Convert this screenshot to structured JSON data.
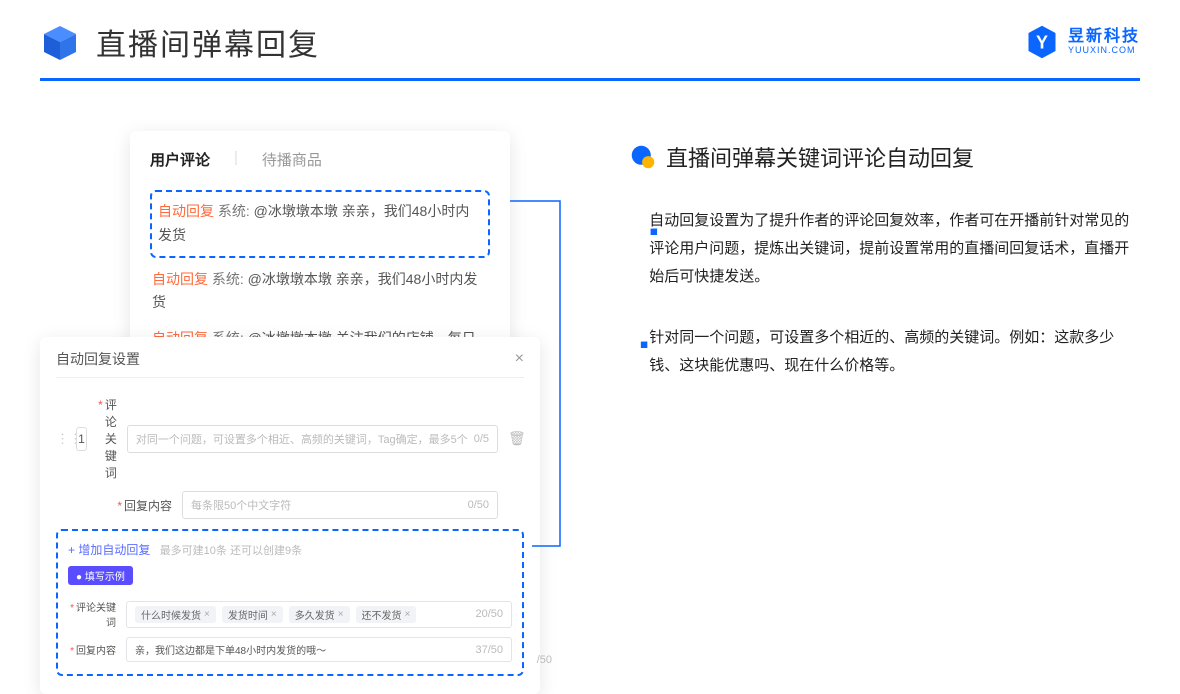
{
  "header": {
    "title": "直播间弹幕回复",
    "brand_cn": "昱新科技",
    "brand_en": "YUUXIN.COM"
  },
  "comments": {
    "tab_active": "用户评论",
    "tab_inactive": "待播商品",
    "items": [
      {
        "badge": "自动回复",
        "sys": "系统:",
        "text": "@冰墩墩本墩 亲亲，我们48小时内发货"
      },
      {
        "badge": "自动回复",
        "sys": "系统:",
        "text": "@冰墩墩本墩 亲亲，我们48小时内发货"
      },
      {
        "badge": "自动回复",
        "sys": "系统:",
        "text": "@冰墩墩本墩 关注我们的店铺，每日都有热门推荐呦～"
      }
    ]
  },
  "settings": {
    "title": "自动回复设置",
    "seq": "1",
    "keyword_label": "评论关键词",
    "keyword_placeholder": "对同一个问题，可设置多个相近、高频的关键词，Tag确定，最多5个",
    "keyword_counter": "0/5",
    "content_label": "回复内容",
    "content_placeholder": "每条限50个中文字符",
    "content_counter": "0/50",
    "add_link": "+ 增加自动回复",
    "add_tip": "最多可建10条 还可以创建9条",
    "example_badge": "● 填写示例",
    "ex_keyword_label": "评论关键词",
    "ex_tags": [
      "什么时候发货",
      "发货时间",
      "多久发货",
      "还不发货"
    ],
    "ex_keyword_counter": "20/50",
    "ex_content_label": "回复内容",
    "ex_content_value": "亲，我们这边都是下单48小时内发货的哦～",
    "ex_content_counter": "37/50",
    "stray_counter": "/50"
  },
  "right": {
    "title": "直播间弹幕关键词评论自动回复",
    "bullets": [
      "自动回复设置为了提升作者的评论回复效率，作者可在开播前针对常见的评论用户问题，提炼出关键词，提前设置常用的直播间回复话术，直播开始后可快捷发送。",
      "针对同一个问题，可设置多个相近的、高频的关键词。例如：这款多少钱、这块能优惠吗、现在什么价格等。"
    ]
  }
}
